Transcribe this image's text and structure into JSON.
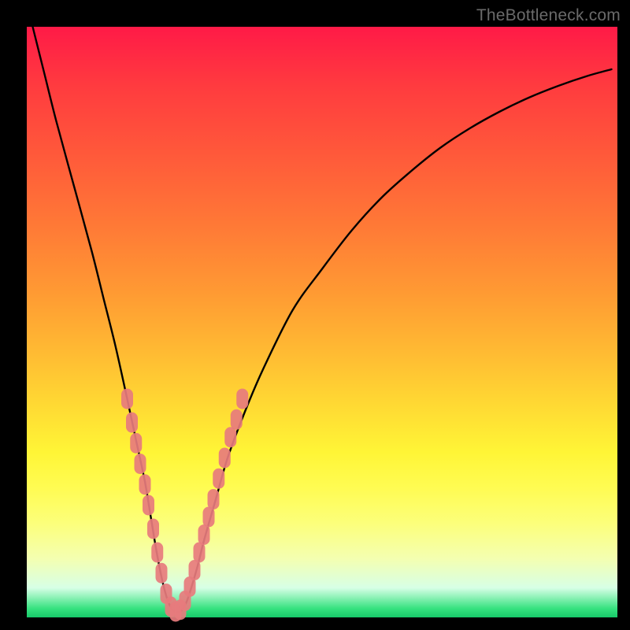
{
  "watermark": "TheBottleneck.com",
  "colors": {
    "frame": "#000000",
    "curve": "#000000",
    "marker_fill": "#e77b7d",
    "marker_stroke": "#e77b7d"
  },
  "chart_data": {
    "type": "line",
    "title": "",
    "xlabel": "",
    "ylabel": "",
    "xlim": [
      0,
      100
    ],
    "ylim": [
      0,
      100
    ],
    "note": "V-shaped bottleneck curve on a rainbow gradient. Values estimated from pixels; axes are unlabeled in the source image.",
    "series": [
      {
        "name": "bottleneck-curve",
        "x": [
          1,
          3,
          5,
          8,
          11,
          13,
          15,
          17,
          18.5,
          20,
          21,
          22,
          23,
          24,
          25,
          26,
          27,
          28,
          29,
          30,
          32,
          34,
          37,
          40,
          45,
          50,
          55,
          60,
          65,
          70,
          75,
          80,
          85,
          90,
          95,
          99
        ],
        "y": [
          100,
          92,
          84,
          73,
          62,
          54,
          46,
          37,
          30,
          23,
          17,
          11,
          6,
          2.5,
          1,
          1,
          2.5,
          5.5,
          9,
          13,
          20,
          27,
          35,
          42,
          52,
          59,
          65.5,
          71,
          75.5,
          79.5,
          82.8,
          85.6,
          88,
          90,
          91.7,
          92.8
        ]
      }
    ],
    "markers": {
      "name": "highlight-band",
      "note": "Pink lozenge markers clustered near the valley of the curve.",
      "points": [
        {
          "x": 17.0,
          "y": 37.0
        },
        {
          "x": 17.8,
          "y": 33.0
        },
        {
          "x": 18.5,
          "y": 29.5
        },
        {
          "x": 19.2,
          "y": 26.0
        },
        {
          "x": 20.0,
          "y": 22.5
        },
        {
          "x": 20.6,
          "y": 19.0
        },
        {
          "x": 21.4,
          "y": 15.0
        },
        {
          "x": 22.1,
          "y": 11.0
        },
        {
          "x": 22.8,
          "y": 7.5
        },
        {
          "x": 23.6,
          "y": 4.0
        },
        {
          "x": 24.4,
          "y": 1.8
        },
        {
          "x": 25.2,
          "y": 1.0
        },
        {
          "x": 26.0,
          "y": 1.3
        },
        {
          "x": 26.8,
          "y": 2.8
        },
        {
          "x": 27.6,
          "y": 5.2
        },
        {
          "x": 28.4,
          "y": 8.0
        },
        {
          "x": 29.2,
          "y": 11.0
        },
        {
          "x": 30.0,
          "y": 14.0
        },
        {
          "x": 30.8,
          "y": 17.0
        },
        {
          "x": 31.6,
          "y": 20.0
        },
        {
          "x": 32.5,
          "y": 23.5
        },
        {
          "x": 33.5,
          "y": 27.0
        },
        {
          "x": 34.5,
          "y": 30.5
        },
        {
          "x": 35.5,
          "y": 33.5
        },
        {
          "x": 36.5,
          "y": 37.0
        }
      ]
    },
    "gradient_stops": [
      {
        "pos": 0.0,
        "color": "#ff1a47"
      },
      {
        "pos": 0.25,
        "color": "#ff6a37"
      },
      {
        "pos": 0.5,
        "color": "#ffc233"
      },
      {
        "pos": 0.72,
        "color": "#fff536"
      },
      {
        "pos": 0.88,
        "color": "#f6ff9a"
      },
      {
        "pos": 0.985,
        "color": "#36e27f"
      },
      {
        "pos": 1.0,
        "color": "#17c96a"
      }
    ]
  }
}
